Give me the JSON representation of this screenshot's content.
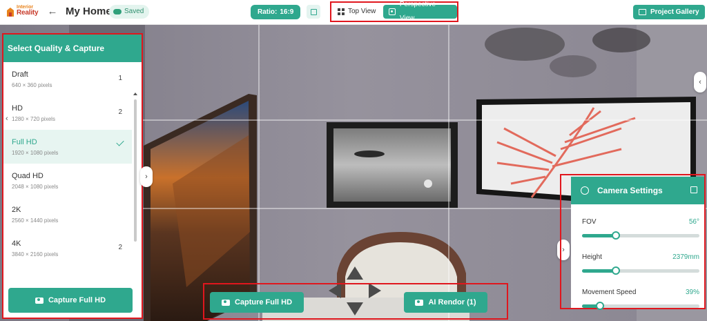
{
  "app": {
    "logo_line1": "Interior",
    "logo_line2": "Reality",
    "title": "My Home",
    "saved_label": "Saved"
  },
  "toolbar": {
    "ratio_label": "Ratio:",
    "ratio_value": "16:9",
    "top_view_label": "Top View",
    "perspective_view_label": "Perspective View",
    "project_gallery_label": "Project Gallery"
  },
  "quality_panel": {
    "title": "Select Quality & Capture",
    "items": [
      {
        "name": "Draft",
        "pixels": "640 × 360 pixels",
        "count": "1",
        "selected": false
      },
      {
        "name": "HD",
        "pixels": "1280 × 720 pixels",
        "count": "2",
        "selected": false
      },
      {
        "name": "Full HD",
        "pixels": "1920 × 1080 pixels",
        "count": "",
        "selected": true
      },
      {
        "name": "Quad HD",
        "pixels": "2048 × 1080 pixels",
        "count": "",
        "selected": false
      },
      {
        "name": "2K",
        "pixels": "2560 × 1440 pixels",
        "count": "",
        "selected": false
      },
      {
        "name": "4K",
        "pixels": "3840 × 2160 pixels",
        "count": "2",
        "selected": false
      }
    ],
    "capture_button_label": "Capture Full HD"
  },
  "bottom_bar": {
    "capture_button_label": "Capture Full HD",
    "ai_render_button_label": "AI Rendor (1)"
  },
  "camera_settings": {
    "title": "Camera Settings",
    "sliders": [
      {
        "label": "FOV",
        "value_text": "56°",
        "level": 0.29
      },
      {
        "label": "Height",
        "value_text": "2379mm",
        "level": 0.29
      },
      {
        "label": "Movement Speed",
        "value_text": "39%",
        "level": 0.15
      }
    ]
  },
  "colors": {
    "accent": "#2fa88e",
    "highlight_border": "#e0161d",
    "wall": "#8f8b96"
  }
}
